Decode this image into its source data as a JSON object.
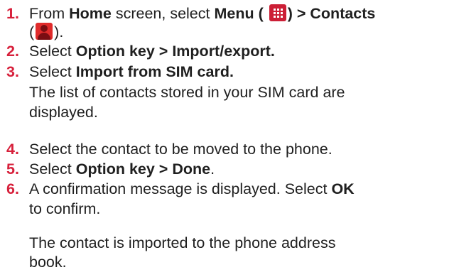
{
  "steps": [
    {
      "number": "1.",
      "parts": {
        "p1": "From ",
        "b1": "Home",
        "p2": " screen, select ",
        "b2": "Menu (",
        "b3": ") > Contacts",
        "p3": "(",
        "p4": ")."
      },
      "icons": [
        "menu-grid-icon",
        "contacts-person-icon"
      ]
    },
    {
      "number": "2.",
      "parts": {
        "p1": "Select ",
        "b1": "Option key > Import/export."
      }
    },
    {
      "number": "3.",
      "parts": {
        "p1": "Select ",
        "b1": "Import from SIM card.",
        "line2": "The list of contacts stored in your SIM card are",
        "line3": "displayed."
      }
    },
    {
      "number": "4.",
      "parts": {
        "p1": "Select the contact to be moved to the phone."
      }
    },
    {
      "number": "5.",
      "parts": {
        "p1": "Select ",
        "b1": "Option key > Done",
        "p2": "."
      }
    },
    {
      "number": "6.",
      "parts": {
        "p1": "A confirmation message is displayed. Select ",
        "b1": "OK",
        "line2": "to confirm."
      }
    }
  ],
  "note": {
    "line1": "The contact is imported to the phone address",
    "line2": "book."
  },
  "colors": {
    "step_number": "#d7203b",
    "text": "#1f1f1f",
    "menu_icon": "#cc1f36",
    "contacts_icon": "#e02b2b"
  }
}
